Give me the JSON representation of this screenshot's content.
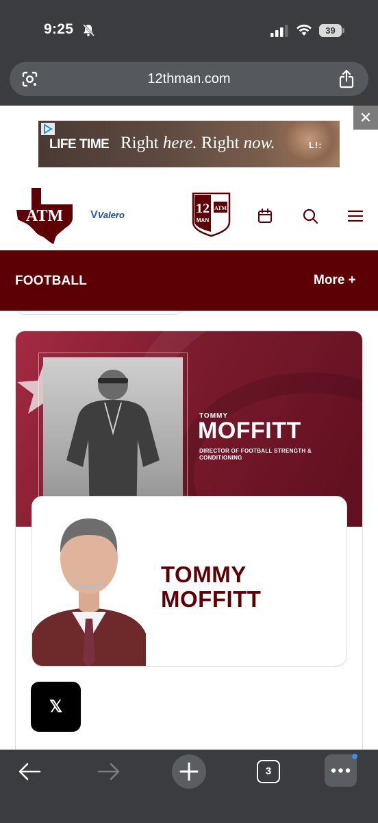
{
  "status_bar": {
    "time": "9:25",
    "battery": "39"
  },
  "browser": {
    "url": "12thman.com",
    "tab_count": "3"
  },
  "ad": {
    "close_label": "✕",
    "brand": "LIFE TIME",
    "tagline_part1": "Right ",
    "tagline_here": "here.",
    "tagline_part2": " Right ",
    "tagline_now": "now.",
    "brand_dots": "L!:"
  },
  "header": {
    "logo_text": "ATM",
    "sponsor": "Valero",
    "twelve_man_number": "12",
    "twelve_man_word": "MAN"
  },
  "section": {
    "title": "FOOTBALL",
    "more_label": "More +"
  },
  "hero": {
    "first_name": "TOMMY",
    "last_name": "MOFFITT",
    "role": "DIRECTOR OF FOOTBALL STRENGTH & CONDITIONING"
  },
  "bio": {
    "name_line1": "TOMMY",
    "name_line2": "MOFFITT"
  },
  "social": {
    "x_label": "𝕏"
  },
  "colors": {
    "maroon": "#5c0005",
    "chrome_bg": "#3a3c3f"
  }
}
